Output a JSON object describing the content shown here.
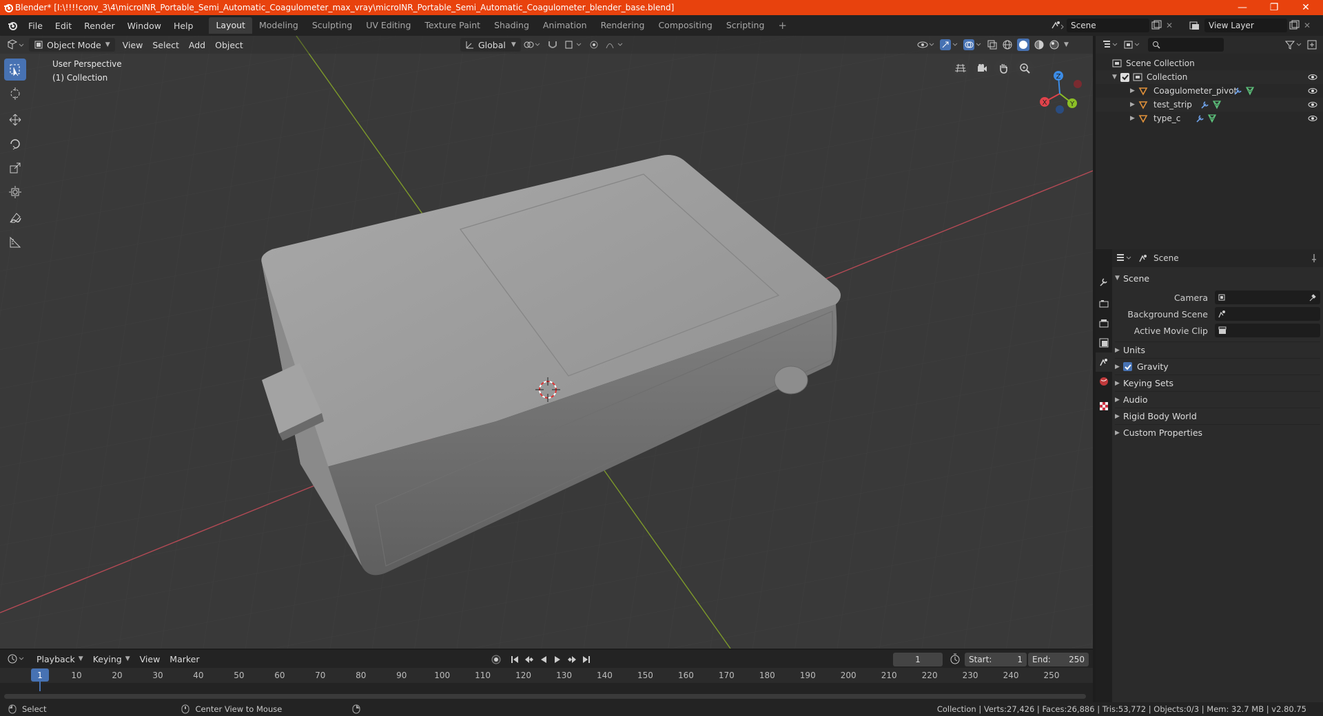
{
  "titlebar": {
    "title": "Blender* [I:\\!!!!conv_3\\4\\microINR_Portable_Semi_Automatic_Coagulometer_max_vray\\microINR_Portable_Semi_Automatic_Coagulometer_blender_base.blend]",
    "minimize": "—",
    "maximize": "❐",
    "close": "✕"
  },
  "menu": [
    "File",
    "Edit",
    "Render",
    "Window",
    "Help"
  ],
  "workspaces": [
    "Layout",
    "Modeling",
    "Sculpting",
    "UV Editing",
    "Texture Paint",
    "Shading",
    "Animation",
    "Rendering",
    "Compositing",
    "Scripting"
  ],
  "workspace_active": "Layout",
  "scene": {
    "name": "Scene",
    "view_layer": "View Layer"
  },
  "viewport": {
    "mode": "Object Mode",
    "menus": [
      "View",
      "Select",
      "Add",
      "Object"
    ],
    "orientation": "Global",
    "perspective_label": "User Perspective",
    "collection_label": "(1) Collection",
    "gizmo_axes": {
      "x": "X",
      "y": "Y",
      "z": "Z"
    }
  },
  "outliner": {
    "search_placeholder": "",
    "root": "Scene Collection",
    "collection": "Collection",
    "objects": [
      "Coagulometer_pivot",
      "test_strip",
      "type_c"
    ]
  },
  "properties": {
    "context": "Scene",
    "panel_title": "Scene",
    "rows": [
      {
        "label": "Camera",
        "value": ""
      },
      {
        "label": "Background Scene",
        "value": ""
      },
      {
        "label": "Active Movie Clip",
        "value": ""
      }
    ],
    "sections": [
      "Units",
      "Gravity",
      "Keying Sets",
      "Audio",
      "Rigid Body World",
      "Custom Properties"
    ],
    "gravity_checked": true
  },
  "timeline": {
    "menus": [
      "Playback",
      "Keying",
      "View",
      "Marker"
    ],
    "current_frame": "1",
    "start_label": "Start:",
    "start": "1",
    "end_label": "End:",
    "end": "250",
    "ticks": [
      "1",
      "10",
      "20",
      "30",
      "40",
      "50",
      "60",
      "70",
      "80",
      "90",
      "100",
      "110",
      "120",
      "130",
      "140",
      "150",
      "160",
      "170",
      "180",
      "190",
      "200",
      "210",
      "220",
      "230",
      "240",
      "250"
    ]
  },
  "statusbar": {
    "left_action": "Select",
    "middle_action": "Center View to Mouse",
    "stats": "Collection | Verts:27,426 | Faces:26,886 | Tris:53,772 | Objects:0/3 | Mem: 32.7 MB | v2.80.75"
  },
  "colors": {
    "accent": "#4772b3",
    "titlebar": "#e8420d",
    "x_axis": "#e0434b",
    "y_axis": "#8cbf26",
    "z_axis": "#3c8ce6"
  }
}
